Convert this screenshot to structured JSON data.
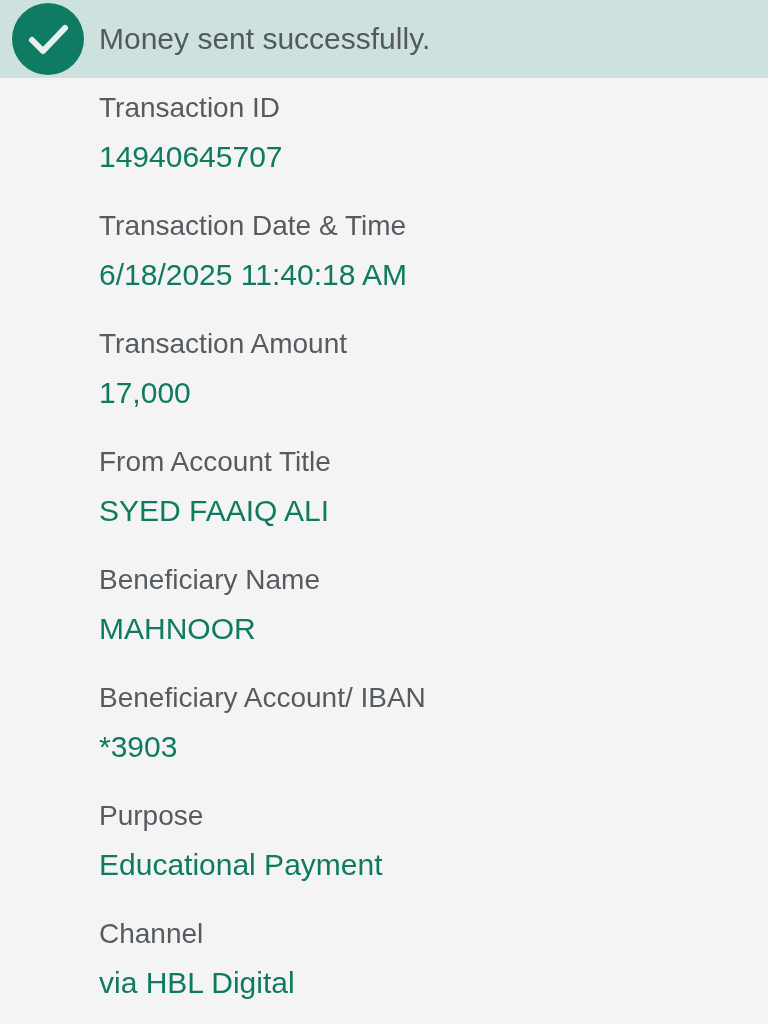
{
  "banner": {
    "message": "Money sent successfully."
  },
  "details": [
    {
      "label": "Transaction ID",
      "value": "14940645707"
    },
    {
      "label": "Transaction Date & Time",
      "value": "6/18/2025 11:40:18 AM"
    },
    {
      "label": "Transaction Amount",
      "value": "17,000"
    },
    {
      "label": "From Account Title",
      "value": "SYED FAAIQ ALI"
    },
    {
      "label": "Beneficiary Name",
      "value": "MAHNOOR"
    },
    {
      "label": "Beneficiary Account/ IBAN",
      "value": "*3903"
    },
    {
      "label": "Purpose",
      "value": "Educational Payment"
    },
    {
      "label": "Channel",
      "value": "via HBL Digital"
    }
  ]
}
